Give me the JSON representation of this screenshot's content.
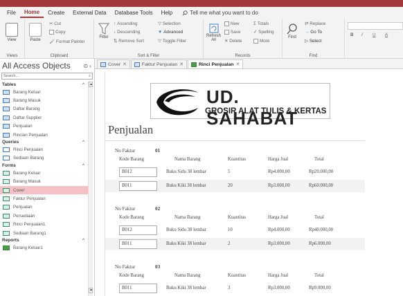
{
  "menu": {
    "items": [
      "File",
      "Home",
      "Create",
      "External Data",
      "Database Tools",
      "Help"
    ],
    "search": "Tell me what you want to do"
  },
  "ribbon": {
    "views": {
      "label": "View",
      "group": "Views"
    },
    "clipboard": {
      "paste": "Paste",
      "cut": "Cut",
      "copy": "Copy",
      "painter": "Format Painter",
      "group": "Clipboard"
    },
    "sort": {
      "filter": "Filter",
      "asc": "Ascending",
      "desc": "Descending",
      "remove": "Remove Sort",
      "selection": "Selection",
      "advanced": "Advanced",
      "toggle": "Toggle Filter",
      "group": "Sort & Filter"
    },
    "records": {
      "refresh": "Refresh",
      "refresh2": "All",
      "new": "New",
      "save": "Save",
      "delete": "Delete",
      "totals": "Totals",
      "spelling": "Spelling",
      "more": "More",
      "group": "Records"
    },
    "find": {
      "find": "Find",
      "replace": "Replace",
      "goto": "Go To",
      "select": "Select",
      "group": "Find"
    },
    "format": {
      "b": "B",
      "i": "I",
      "u": "U",
      "a": "A"
    }
  },
  "nav": {
    "title": "All Access Objects",
    "search_placeholder": "Search...",
    "sections": [
      {
        "name": "Tables",
        "type": "table",
        "items": [
          "Barang Keluar",
          "Barang Masuk",
          "Daftar Barang",
          "Daftar Supplier",
          "Penjualan",
          "Rincian Penjualan"
        ]
      },
      {
        "name": "Queries",
        "type": "query",
        "items": [
          "Rinci Penjualan",
          "Sediaan Barang"
        ]
      },
      {
        "name": "Forms",
        "type": "form",
        "items": [
          "Barang Keluar",
          "Barang Masuk",
          "Cover",
          "Faktur Penjualan",
          "Penjualan",
          "Persediaan",
          "Rinci Penjualan1",
          "Sediaan Barang1"
        ]
      },
      {
        "name": "Reports",
        "type": "report",
        "items": [
          "Barang Keluar1"
        ]
      }
    ],
    "selected": "Cover"
  },
  "tabs": [
    {
      "label": "Cover",
      "active": false
    },
    {
      "label": "Faktur Penjualan",
      "active": false
    },
    {
      "label": "Rinci Penjualan",
      "active": true
    }
  ],
  "report": {
    "company": "UD. SAHABAT",
    "tagline": "GROSIR ALAT TULIS & KERTAS",
    "title": "Penjualan",
    "labels": {
      "faktur": "No Faktur",
      "kode": "Kode Barang",
      "nama": "Nama Barang",
      "kuantitas": "Kuantitas",
      "harga": "Harga Jual",
      "total": "Total"
    },
    "groups": [
      {
        "no": "01",
        "rows": [
          {
            "kode": "B012",
            "nama": "Buku Sidu 38 lembar",
            "qty": "5",
            "harga": "Rp4.000,00",
            "total": "Rp20.000,00"
          },
          {
            "kode": "B011",
            "nama": "Buku Kiki 38 lembar",
            "qty": "20",
            "harga": "Rp3.000,00",
            "total": "Rp60.000,00"
          }
        ]
      },
      {
        "no": "02",
        "rows": [
          {
            "kode": "B012",
            "nama": "Buku Sidu 38 lembar",
            "qty": "10",
            "harga": "Rp4.000,00",
            "total": "Rp40.000,00"
          },
          {
            "kode": "B011",
            "nama": "Buku Kiki 38 lembar",
            "qty": "2",
            "harga": "Rp3.000,00",
            "total": "Rp6.000,00"
          }
        ]
      },
      {
        "no": "03",
        "rows": [
          {
            "kode": "B011",
            "nama": "Buku Kiki 38 lembar",
            "qty": "3",
            "harga": "Rp3.000,00",
            "total": "Rp9.000,00"
          }
        ]
      }
    ]
  },
  "colors": {
    "accent": "#a4373a",
    "selected": "#f4c2c6"
  }
}
